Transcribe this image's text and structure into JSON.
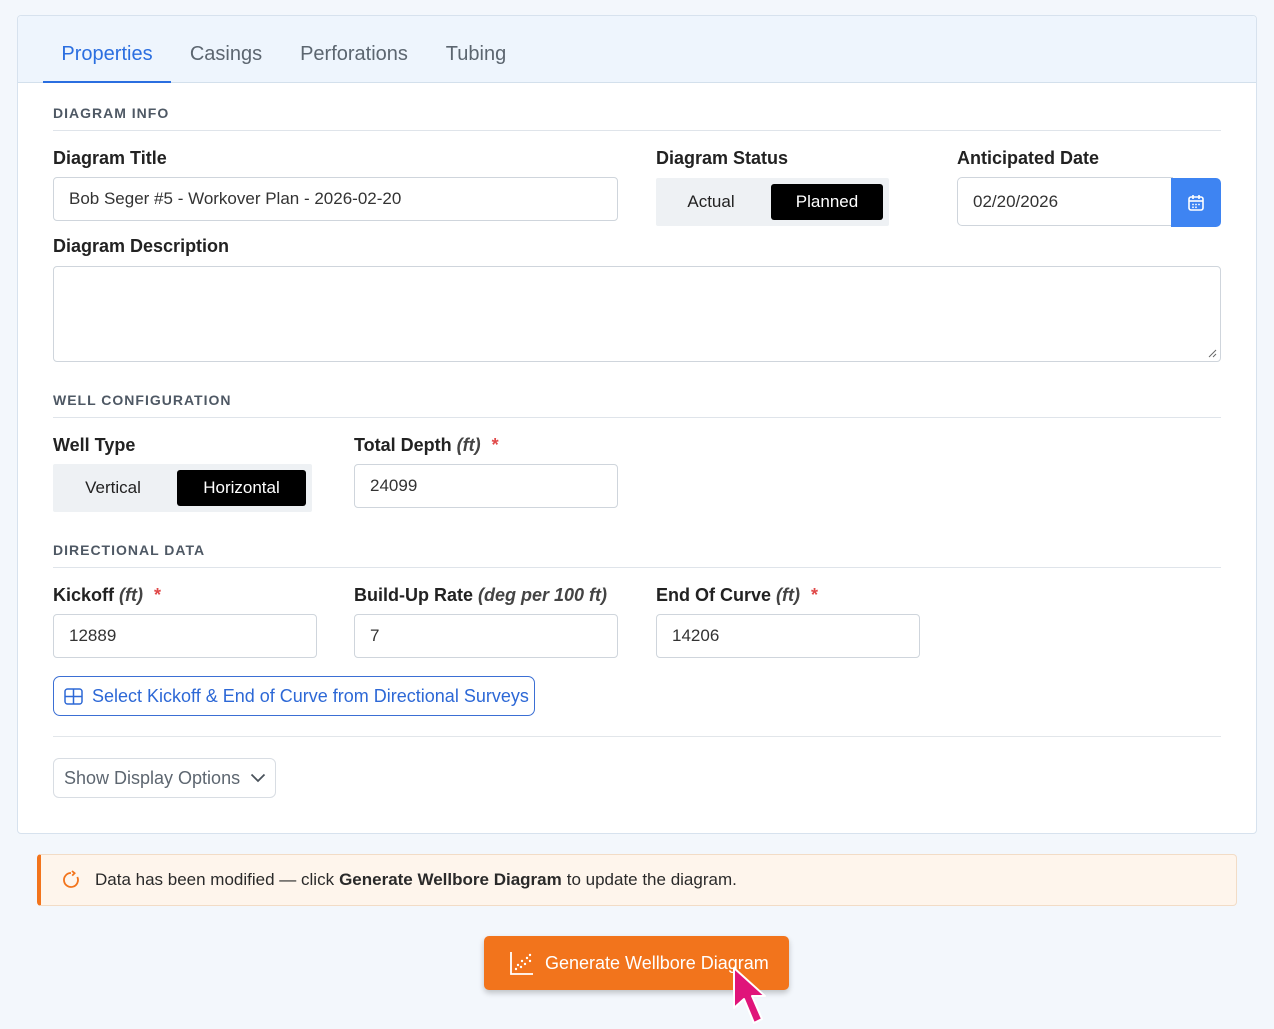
{
  "tabs": [
    {
      "label": "Properties",
      "active": true
    },
    {
      "label": "Casings",
      "active": false
    },
    {
      "label": "Perforations",
      "active": false
    },
    {
      "label": "Tubing",
      "active": false
    }
  ],
  "diagram_info": {
    "section_title": "DIAGRAM INFO",
    "title_label": "Diagram Title",
    "title_value": "Bob Seger #5 - Workover Plan - 2026-02-20",
    "status_label": "Diagram Status",
    "status_options": [
      "Actual",
      "Planned"
    ],
    "status_selected": "Planned",
    "date_label": "Anticipated Date",
    "date_value": "02/20/2026",
    "description_label": "Diagram Description",
    "description_value": ""
  },
  "well_config": {
    "section_title": "WELL CONFIGURATION",
    "well_type_label": "Well Type",
    "well_type_options": [
      "Vertical",
      "Horizontal"
    ],
    "well_type_selected": "Horizontal",
    "total_depth_label": "Total Depth",
    "total_depth_unit": "(ft)",
    "total_depth_value": "24099"
  },
  "directional": {
    "section_title": "DIRECTIONAL DATA",
    "kickoff_label": "Kickoff",
    "kickoff_unit": "(ft)",
    "kickoff_value": "12889",
    "build_label": "Build-Up Rate",
    "build_unit": "(deg per 100 ft)",
    "build_value": "7",
    "eoc_label": "End Of Curve",
    "eoc_unit": "(ft)",
    "eoc_value": "14206",
    "select_button": "Select Kickoff & End of Curve from Directional Surveys"
  },
  "display_options_button": "Show Display Options",
  "notice": {
    "prefix": "Data has been modified — click",
    "bold": "Generate Wellbore Diagram",
    "suffix": "to update the diagram."
  },
  "generate_button": "Generate Wellbore Diagram",
  "required_marker": "*",
  "icons": {
    "date": "calendar-icon",
    "select": "table-grid-icon",
    "display": "chevron-down-icon",
    "notice": "refresh-icon",
    "generate": "scatter-chart-icon",
    "pointer": "mouse-pointer-icon"
  },
  "colors": {
    "accent_blue": "#2a6ee0",
    "date_button": "#3e84f2",
    "generate_orange": "#f2741c",
    "cursor_magenta": "#e0147a"
  }
}
